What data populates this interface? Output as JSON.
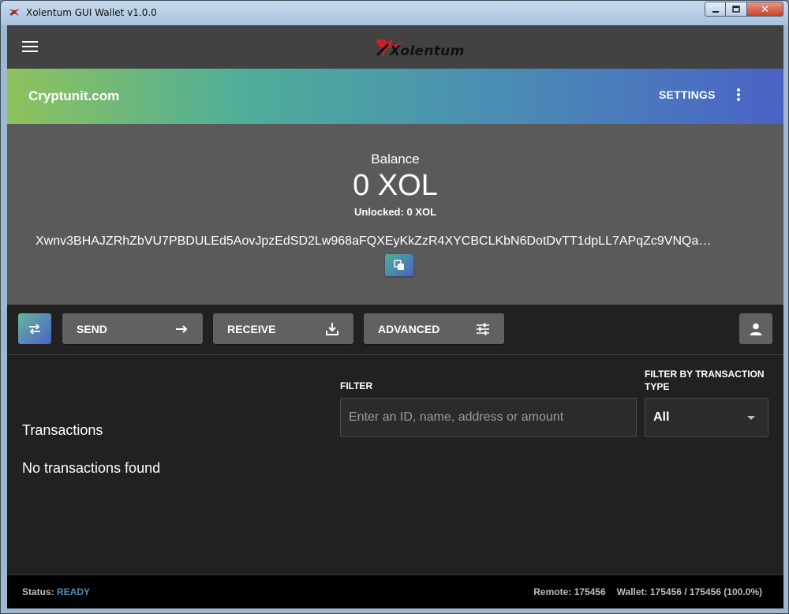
{
  "window": {
    "title": "Xolentum GUI Wallet v1.0.0",
    "min_icon": "minimize-icon",
    "max_icon": "maximize-icon",
    "close_icon": "close-icon",
    "close_glyph": "✕"
  },
  "appbar": {
    "logo_text": "Xolentum",
    "menu_icon": "menu-icon"
  },
  "header": {
    "site_name": "Cryptunit.com",
    "settings_label": "SETTINGS",
    "more_icon": "more-vert-icon"
  },
  "balance": {
    "label": "Balance",
    "value": "0 XOL",
    "unlocked": "Unlocked: 0 XOL",
    "address": "Xwnv3BHAJZRhZbVU7PBDULEd5AovJpzEdSD2Lw968aFQXEyKkZzR4XYCBCLKbN6DotDvTT1dpLL7APqZc9VNQa…",
    "copy_icon": "copy-icon"
  },
  "toolbar": {
    "swap_icon": "swap-icon",
    "send_label": "SEND",
    "send_icon": "arrow-right-icon",
    "receive_label": "RECEIVE",
    "receive_icon": "download-icon",
    "advanced_label": "ADVANCED",
    "advanced_icon": "tune-icon",
    "account_icon": "person-icon"
  },
  "transactions": {
    "title": "Transactions",
    "empty_text": "No transactions found",
    "filter_label": "FILTER",
    "filter_placeholder": "Enter an ID, name, address or amount",
    "filter_value": "",
    "type_label": "FILTER BY TRANSACTION TYPE",
    "type_selected": "All"
  },
  "status": {
    "label": "Status:",
    "value": "READY",
    "remote": "Remote: 175456",
    "wallet": "Wallet: 175456 / 175456 (100.0%)"
  },
  "colors": {
    "accent_blue": "#4a8fb3",
    "gradient_start": "#8fc25d",
    "gradient_end": "#4a62c6",
    "logo_red": "#d0202a"
  }
}
